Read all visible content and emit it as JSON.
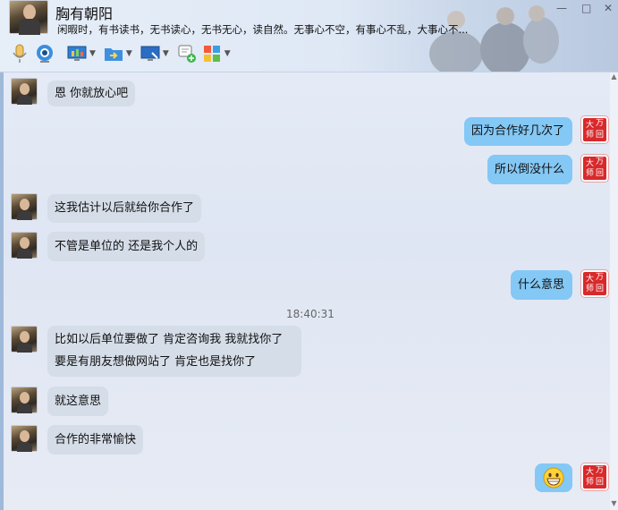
{
  "contact": {
    "name": "胸有朝阳",
    "status": "闲暇时，有书读书，无书读心，无书无心，读自然。无事心不空，有事心不乱，大事心不..."
  },
  "window_controls": [
    "—",
    "□",
    "✕"
  ],
  "toolbar_icons": [
    "microphone-icon",
    "video-camera-icon",
    "screen-share-icon",
    "file-transfer-icon",
    "remote-desktop-icon",
    "new-chat-icon",
    "apps-icon"
  ],
  "stamp": {
    "line1": "大",
    "line2": "万",
    "line3": "师",
    "line4": "回"
  },
  "timestamp": "18:40:31",
  "messages": [
    {
      "side": "in",
      "text": "恩  你就放心吧"
    },
    {
      "side": "out",
      "text": "因为合作好几次了"
    },
    {
      "side": "out",
      "text": "所以倒没什么"
    },
    {
      "side": "in",
      "text": "这我估计以后就给你合作了"
    },
    {
      "side": "in",
      "text": "不管是单位的  还是我个人的"
    },
    {
      "side": "out",
      "text": "什么意思"
    },
    {
      "side": "in",
      "text": "比如以后单位要做了  肯定咨询我    我就找你了",
      "text2": "要是有朋友想做网站了  肯定也是找你了"
    },
    {
      "side": "in",
      "text": "就这意思"
    },
    {
      "side": "in",
      "text": "合作的非常愉快"
    },
    {
      "side": "out",
      "emoji": "grinning-face-emoji"
    }
  ]
}
